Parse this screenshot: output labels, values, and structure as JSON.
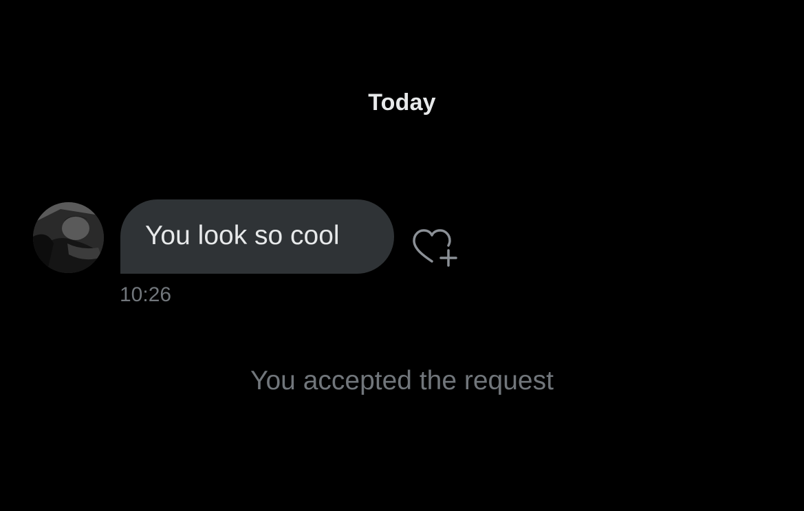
{
  "conversation": {
    "date_divider": "Today",
    "messages": [
      {
        "sender": "other",
        "text": "You look so cool",
        "time": "10:26",
        "react_icon": "heart-plus-icon"
      }
    ],
    "system_note": "You accepted the request"
  },
  "theme": {
    "background": "#000000",
    "bubble": "#2f3336",
    "primary_text": "#e7e9ea",
    "secondary_text": "#71767b"
  }
}
